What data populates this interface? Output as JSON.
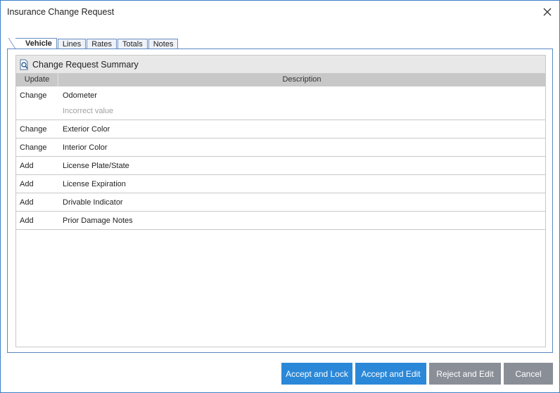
{
  "window": {
    "title": "Insurance Change Request"
  },
  "tabs": [
    {
      "label": "Vehicle",
      "active": true
    },
    {
      "label": "Lines",
      "active": false
    },
    {
      "label": "Rates",
      "active": false
    },
    {
      "label": "Totals",
      "active": false
    },
    {
      "label": "Notes",
      "active": false
    }
  ],
  "summary": {
    "title": "Change Request Summary",
    "icon": "magnifier-document-icon"
  },
  "table": {
    "headers": {
      "update": "Update",
      "description": "Description"
    },
    "rows": [
      {
        "update": "Change",
        "description": "Odometer",
        "note": "Incorrect value"
      },
      {
        "update": "Change",
        "description": "Exterior Color"
      },
      {
        "update": "Change",
        "description": "Interior Color"
      },
      {
        "update": "Add",
        "description": "License Plate/State"
      },
      {
        "update": "Add",
        "description": "License Expiration"
      },
      {
        "update": "Add",
        "description": "Drivable Indicator"
      },
      {
        "update": "Add",
        "description": "Prior Damage Notes"
      }
    ]
  },
  "buttons": {
    "accept_lock": "Accept and Lock",
    "accept_edit": "Accept and Edit",
    "reject_edit": "Reject and Edit",
    "cancel": "Cancel"
  },
  "colors": {
    "primary_button": "#2b88d8",
    "secondary_button": "#8a8f97",
    "window_border": "#3c7fc7"
  }
}
